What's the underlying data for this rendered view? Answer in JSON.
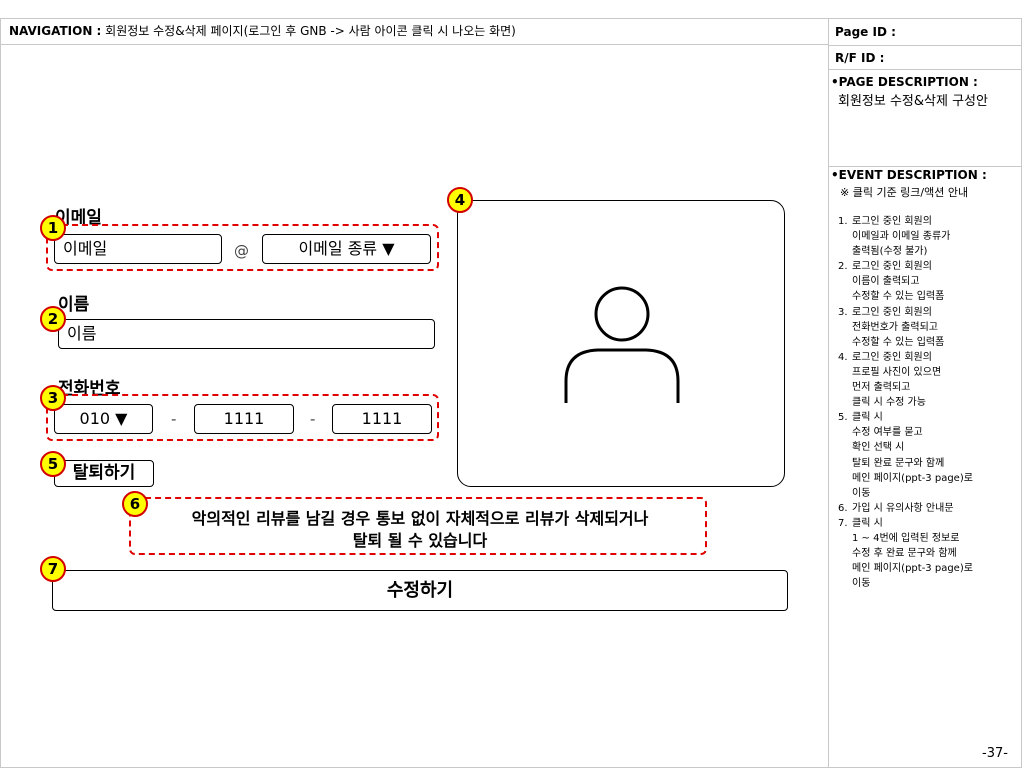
{
  "header": {
    "nav_prefix": "NAVIGATION :",
    "nav_text": "회원정보 수정&삭제 페이지(로그인 후 GNB -> 사람 아이콘 클릭 시 나오는 화면)"
  },
  "side": {
    "page_id": "Page ID :",
    "rf_id": "R/F ID :",
    "page_desc_title": "•PAGE DESCRIPTION :",
    "page_desc_text": "회원정보 수정&삭제 구성안",
    "event_title": "•EVENT DESCRIPTION :",
    "event_sub": "※ 클릭 기준 링크/액션 안내",
    "events": [
      {
        "num": "1.",
        "lines": [
          "로그인 중인 회원의",
          "이메일과 이메일 종류가",
          "출력됨(수정 불가)"
        ]
      },
      {
        "num": "2.",
        "lines": [
          "로그인 중인 회원의",
          "이름이 출력되고",
          "수정할 수 있는 입력폼"
        ]
      },
      {
        "num": "3.",
        "lines": [
          "로그인 중인 회원의",
          "전화번호가 출력되고",
          "수정할 수 있는 입력폼"
        ]
      },
      {
        "num": "4.",
        "lines": [
          "로그인 중인 회원의",
          "프로필 사진이 있으면",
          "먼저 출력되고",
          "클릭 시 수정 가능"
        ]
      },
      {
        "num": "5.",
        "lines": [
          "클릭 시",
          "수정 여부를 묻고",
          "확인 선택 시",
          "탈퇴 완료 문구와 함께",
          "메인 페이지(ppt-3 page)로",
          "이동"
        ]
      },
      {
        "num": "6.",
        "lines": [
          "가입 시 유의사항 안내문"
        ]
      },
      {
        "num": "7.",
        "lines": [
          "클릭 시",
          "1 ~ 4번에 입력된 정보로",
          "수정 후 완료 문구와 함께",
          "메인 페이지(ppt-3 page)로",
          "이동"
        ]
      }
    ],
    "page_number": "-37-"
  },
  "form": {
    "email_label": "이메일",
    "email_value": "이메일",
    "at_sign": "@",
    "email_domain": "이메일 종류 ▼",
    "name_label": "이름",
    "name_value": "이름",
    "phone_label": "전화번호",
    "phone_prefix": "010 ▼",
    "phone_dash": "-",
    "phone_mid": "1111",
    "phone_last": "1111",
    "withdraw_label": "탈퇴하기",
    "notice_line1": "악의적인 리뷰를 남길 경우 통보 없이 자체적으로 리뷰가 삭제되거나",
    "notice_line2": "탈퇴 될 수 있습니다",
    "submit_label": "수정하기",
    "profile_icon": "user-profile-icon"
  },
  "badges": [
    "1",
    "2",
    "3",
    "4",
    "5",
    "6",
    "7"
  ],
  "colors": {
    "marker_fill": "#ffff00",
    "marker_border": "#d40000",
    "dashed": "#e00000"
  }
}
